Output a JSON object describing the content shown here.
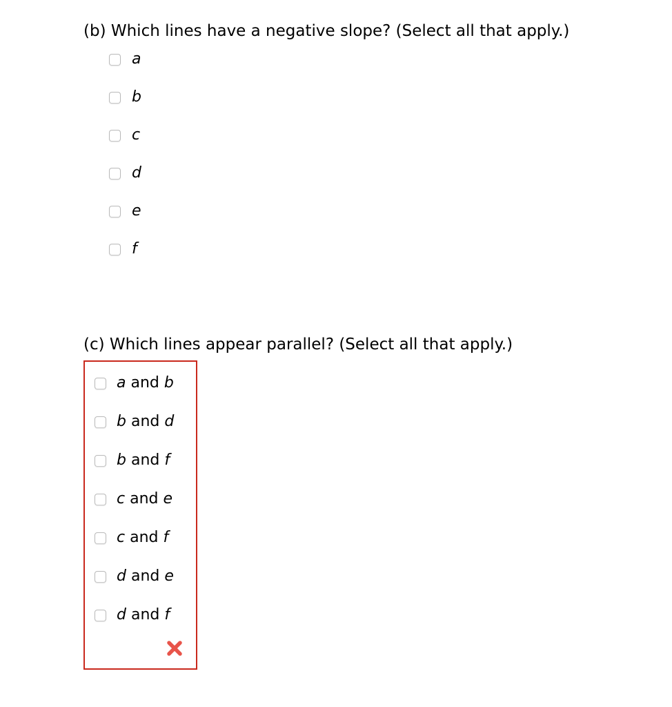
{
  "page": {
    "background_color": "#ffffff",
    "text_color": "#000000"
  },
  "sections": {
    "b": {
      "heading": "(b) Which lines have a negative slope? (Select all that apply.)",
      "options": [
        {
          "label": "a",
          "checked": false
        },
        {
          "label": "b",
          "checked": false
        },
        {
          "label": "c",
          "checked": false
        },
        {
          "label": "d",
          "checked": false
        },
        {
          "label": "e",
          "checked": false
        },
        {
          "label": "f",
          "checked": false
        }
      ]
    },
    "c": {
      "heading": "(c) Which lines appear parallel? (Select all that apply.)",
      "frame_border_color": "#c9281c",
      "options": [
        {
          "first": "a",
          "conjunction": " and ",
          "second": "b",
          "checked": false
        },
        {
          "first": "b",
          "conjunction": " and ",
          "second": "d",
          "checked": false
        },
        {
          "first": "b",
          "conjunction": " and ",
          "second": "f",
          "checked": false
        },
        {
          "first": "c",
          "conjunction": " and ",
          "second": "e",
          "checked": false
        },
        {
          "first": "c",
          "conjunction": " and ",
          "second": "f",
          "checked": false
        },
        {
          "first": "d",
          "conjunction": " and ",
          "second": "e",
          "checked": false
        },
        {
          "first": "d",
          "conjunction": " and ",
          "second": "f",
          "checked": false
        }
      ],
      "feedback": {
        "icon": "cross-mark-icon",
        "symbol": "✗",
        "color": "#e8544a",
        "meaning": "incorrect"
      }
    }
  }
}
